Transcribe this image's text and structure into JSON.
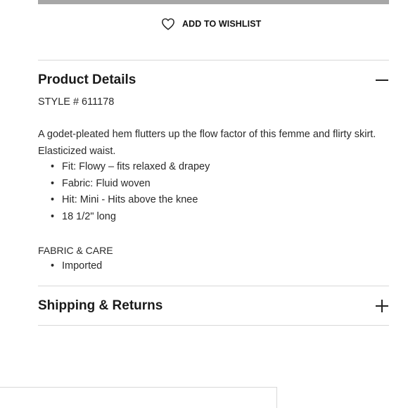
{
  "wishlist": {
    "label": "ADD TO WISHLIST",
    "icon": "heart-outline-icon"
  },
  "product_details": {
    "title": "Product Details",
    "expanded": true,
    "toggle_icon": "minus-icon",
    "style_number": "STYLE # 611178",
    "description": "A godet-pleated hem flutters up the flow factor of this femme and flirty skirt. Elasticized waist.",
    "features": [
      "Fit: Flowy – fits relaxed & drapey",
      "Fabric: Fluid woven",
      "Hit: Mini - Hits above the knee",
      "18 1/2\" long"
    ],
    "fabric_care_label": "FABRIC & CARE",
    "fabric_care_items": [
      "Imported"
    ]
  },
  "shipping_returns": {
    "title": "Shipping & Returns",
    "expanded": false,
    "toggle_icon": "plus-icon"
  },
  "colors": {
    "divider": "#d8d8d8",
    "top_bar": "#a7a7a7",
    "text": "#2a2a2a"
  }
}
